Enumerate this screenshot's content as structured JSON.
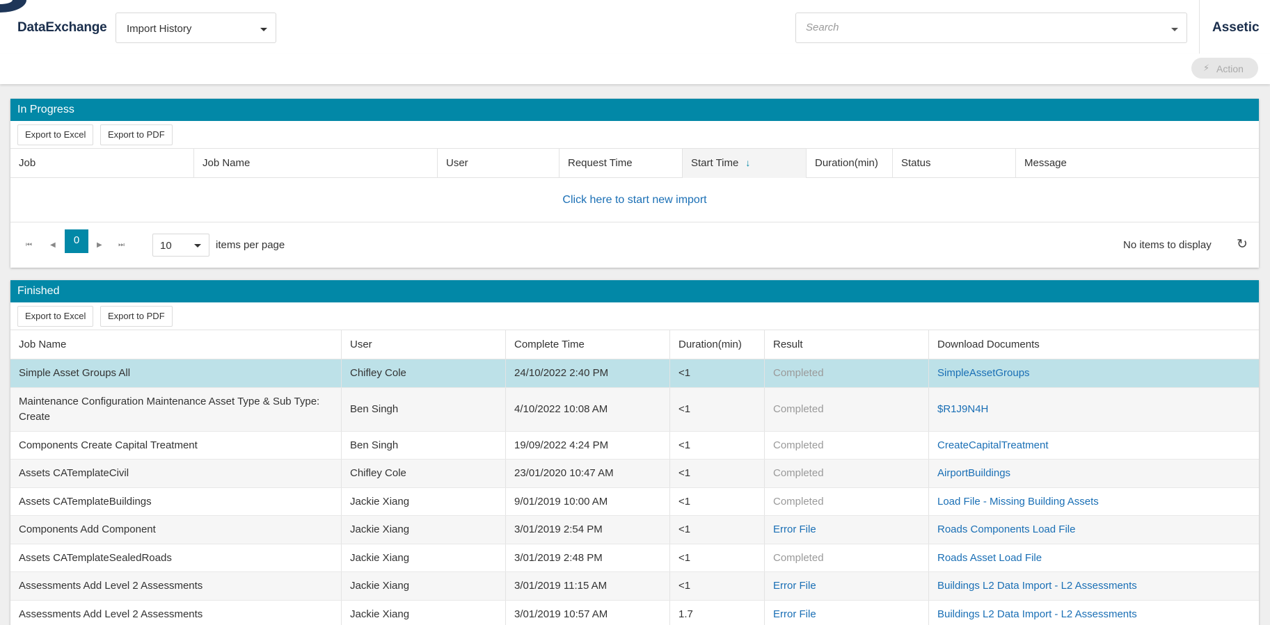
{
  "header": {
    "app_name": "DataExchange",
    "view_selector": {
      "value": "Import History"
    },
    "search": {
      "placeholder": "Search"
    },
    "logo": "Assetic"
  },
  "action_bar": {
    "action_label": "Action",
    "icon": "bolt-icon"
  },
  "in_progress": {
    "title": "In Progress",
    "export_excel": "Export to Excel",
    "export_pdf": "Export to PDF",
    "columns": [
      "Job",
      "Job Name",
      "User",
      "Request Time",
      "Start Time",
      "Duration(min)",
      "Status",
      "Message"
    ],
    "sorted_column": "Start Time",
    "sort_direction": "descending",
    "empty_link": "Click here to start new import",
    "pager": {
      "current_page": "0",
      "page_size": "10",
      "page_size_label": "items per page",
      "status": "No items to display"
    }
  },
  "finished": {
    "title": "Finished",
    "export_excel": "Export to Excel",
    "export_pdf": "Export to PDF",
    "columns": [
      "Job Name",
      "User",
      "Complete Time",
      "Duration(min)",
      "Result",
      "Download Documents"
    ],
    "rows": [
      {
        "job_name": "Simple Asset Groups All",
        "user": "Chifley Cole",
        "complete_time": "24/10/2022 2:40 PM",
        "duration": "<1",
        "result": "Completed",
        "document": "SimpleAssetGroups",
        "selected": true
      },
      {
        "job_name": "Maintenance Configuration Maintenance Asset Type & Sub Type: Create",
        "user": "Ben Singh",
        "complete_time": "4/10/2022 10:08 AM",
        "duration": "<1",
        "result": "Completed",
        "document": "$R1J9N4H"
      },
      {
        "job_name": "Components Create Capital Treatment",
        "user": "Ben Singh",
        "complete_time": "19/09/2022 4:24 PM",
        "duration": "<1",
        "result": "Completed",
        "document": "CreateCapitalTreatment"
      },
      {
        "job_name": "Assets CATemplateCivil",
        "user": "Chifley Cole",
        "complete_time": "23/01/2020 10:47 AM",
        "duration": "<1",
        "result": "Completed",
        "document": "AirportBuildings"
      },
      {
        "job_name": "Assets CATemplateBuildings",
        "user": "Jackie Xiang",
        "complete_time": "9/01/2019 10:00 AM",
        "duration": "<1",
        "result": "Completed",
        "document": "Load File - Missing Building Assets"
      },
      {
        "job_name": "Components Add Component",
        "user": "Jackie Xiang",
        "complete_time": "3/01/2019 2:54 PM",
        "duration": "<1",
        "result": "Error File",
        "document": "Roads Components Load File"
      },
      {
        "job_name": "Assets CATemplateSealedRoads",
        "user": "Jackie Xiang",
        "complete_time": "3/01/2019 2:48 PM",
        "duration": "<1",
        "result": "Completed",
        "document": "Roads Asset Load File"
      },
      {
        "job_name": "Assessments Add Level 2 Assessments",
        "user": "Jackie Xiang",
        "complete_time": "3/01/2019 11:15 AM",
        "duration": "<1",
        "result": "Error File",
        "document": "Buildings L2 Data Import - L2 Assessments"
      },
      {
        "job_name": "Assessments Add Level 2 Assessments",
        "user": "Jackie Xiang",
        "complete_time": "3/01/2019 10:57 AM",
        "duration": "1.7",
        "result": "Error File",
        "document": "Buildings L2 Data Import - L2 Assessments"
      }
    ]
  }
}
